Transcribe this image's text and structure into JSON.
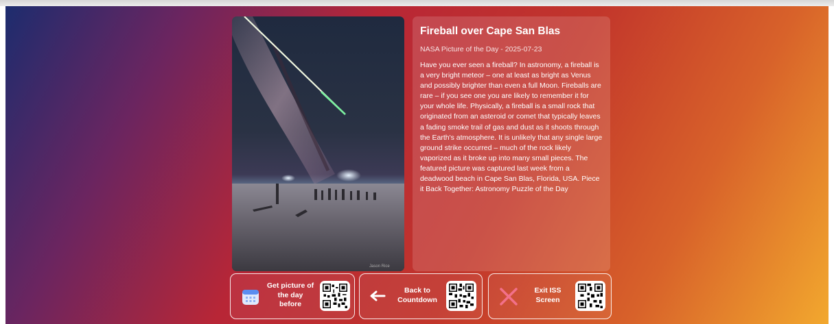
{
  "apod": {
    "title": "Fireball over Cape San Blas",
    "subtitle": "NASA Picture of the Day - 2025-07-23",
    "description": "Have you ever seen a fireball? In astronomy, a fireball is a very bright meteor – one at least as bright as Venus and possibly brighter than even a full Moon. Fireballs are rare – if you see one you are likely to remember it for your whole life. Physically, a fireball is a small rock that originated from an asteroid or comet that typically leaves a fading smoke trail of gas and dust as it shoots through the Earth's atmosphere. It is unlikely that any single large ground strike occurred – much of the rock likely vaporized as it broke up into many small pieces. The featured picture was captured last week from a deadwood beach in Cape San Blas, Florida, USA. Piece it Back Together: Astronomy Puzzle of the Day",
    "photo_credit": "Jason Rice"
  },
  "buttons": {
    "prev_day": {
      "label": "Get picture of the day before",
      "icon": "calendar-icon"
    },
    "back": {
      "label": "Back to Countdown",
      "icon": "arrow-left-icon"
    },
    "exit": {
      "label": "Exit ISS Screen",
      "icon": "close-x-icon"
    }
  },
  "colors": {
    "calendar_icon": "#5b8def",
    "exit_icon": "#f2708a",
    "card_text": "#ffffff"
  }
}
